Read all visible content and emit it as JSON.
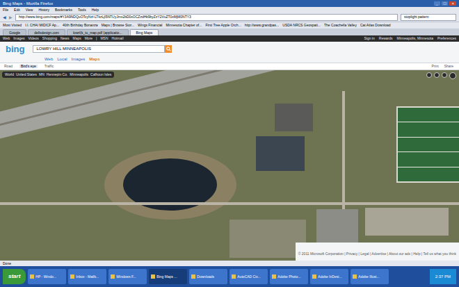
{
  "window": {
    "title": "Bing Maps - Mozilla Firefox",
    "controls": [
      "_",
      "□",
      "×"
    ]
  },
  "menu": [
    "File",
    "Edit",
    "View",
    "History",
    "Bookmarks",
    "Tools",
    "Help"
  ],
  "nav": {
    "back": "◀",
    "forward": "▶",
    "url": "http://www.bing.com/maps/#Y3A9NDQuOTcyNzl-LTkzLjI5NTUyJmx2bD0xOCZzdHk9byZzY2VuZT0xMjM0NTY3",
    "search": "stoplight pattern"
  },
  "bookmarks": [
    "Most Visited",
    "I.I. CHAI MIDICF Ap...",
    "40th Birthday Bonanza",
    "Maps | Browse Stor...",
    "Wings Financial",
    "Minnesota Chapter of...",
    "First Tree Apple Orch...",
    "http://www.grandpas...",
    "USDA NRCS Geospati...",
    "The Coachella Valley",
    "Cat Atlas Download"
  ],
  "tabs": [
    {
      "label": "Google",
      "selected": false
    },
    {
      "label": "dellsdesign.com",
      "selected": false
    },
    {
      "label": "lowrl(k_tu_map.pdf (applicatio...",
      "selected": false
    },
    {
      "label": "Bing Maps",
      "selected": true
    }
  ],
  "bing": {
    "top_links": [
      "Web",
      "Images",
      "Videos",
      "Shopping",
      "News",
      "Maps",
      "More",
      "|",
      "MSN",
      "Hotmail"
    ],
    "account": [
      "Sign in",
      "Rewards",
      "Minneapolis, Minnesota",
      "Preferences"
    ],
    "logo": "bing",
    "query": "LOWRY HILL MINNEAPOLIS",
    "verticals": [
      {
        "label": "Web",
        "selected": false
      },
      {
        "label": "Local",
        "selected": false
      },
      {
        "label": "Images",
        "selected": false
      },
      {
        "label": "Maps",
        "selected": true
      }
    ]
  },
  "map": {
    "views": [
      {
        "label": "Road",
        "selected": false
      },
      {
        "label": "Bird's eye",
        "selected": true
      },
      {
        "label": "Traffic",
        "selected": false
      }
    ],
    "actions": [
      "Print",
      "Share"
    ],
    "breadcrumb": [
      "World",
      "United States",
      "MN",
      "Hennepin Co.",
      "Minneapolis",
      "Calhoun Isles"
    ],
    "footer": "© 2011 Microsoft Corporation | Privacy | Legal | Advertise | About our ads | Help | Tell us what you think"
  },
  "status_bar": {
    "text": "Done"
  },
  "taskbar": {
    "start": "start",
    "items": [
      {
        "label": "HP - Windo...",
        "selected": false
      },
      {
        "label": "Inbox - Mailb...",
        "selected": false
      },
      {
        "label": "Windows F...",
        "selected": false
      },
      {
        "label": "Bing Maps ...",
        "selected": true
      },
      {
        "label": "Downloads",
        "selected": false
      },
      {
        "label": "AutoCAD Civ...",
        "selected": false
      },
      {
        "label": "Adobe Photo...",
        "selected": false
      },
      {
        "label": "Adobe InDesi...",
        "selected": false
      },
      {
        "label": "Adobe Illust...",
        "selected": false
      }
    ],
    "clock": "2:37 PM"
  }
}
